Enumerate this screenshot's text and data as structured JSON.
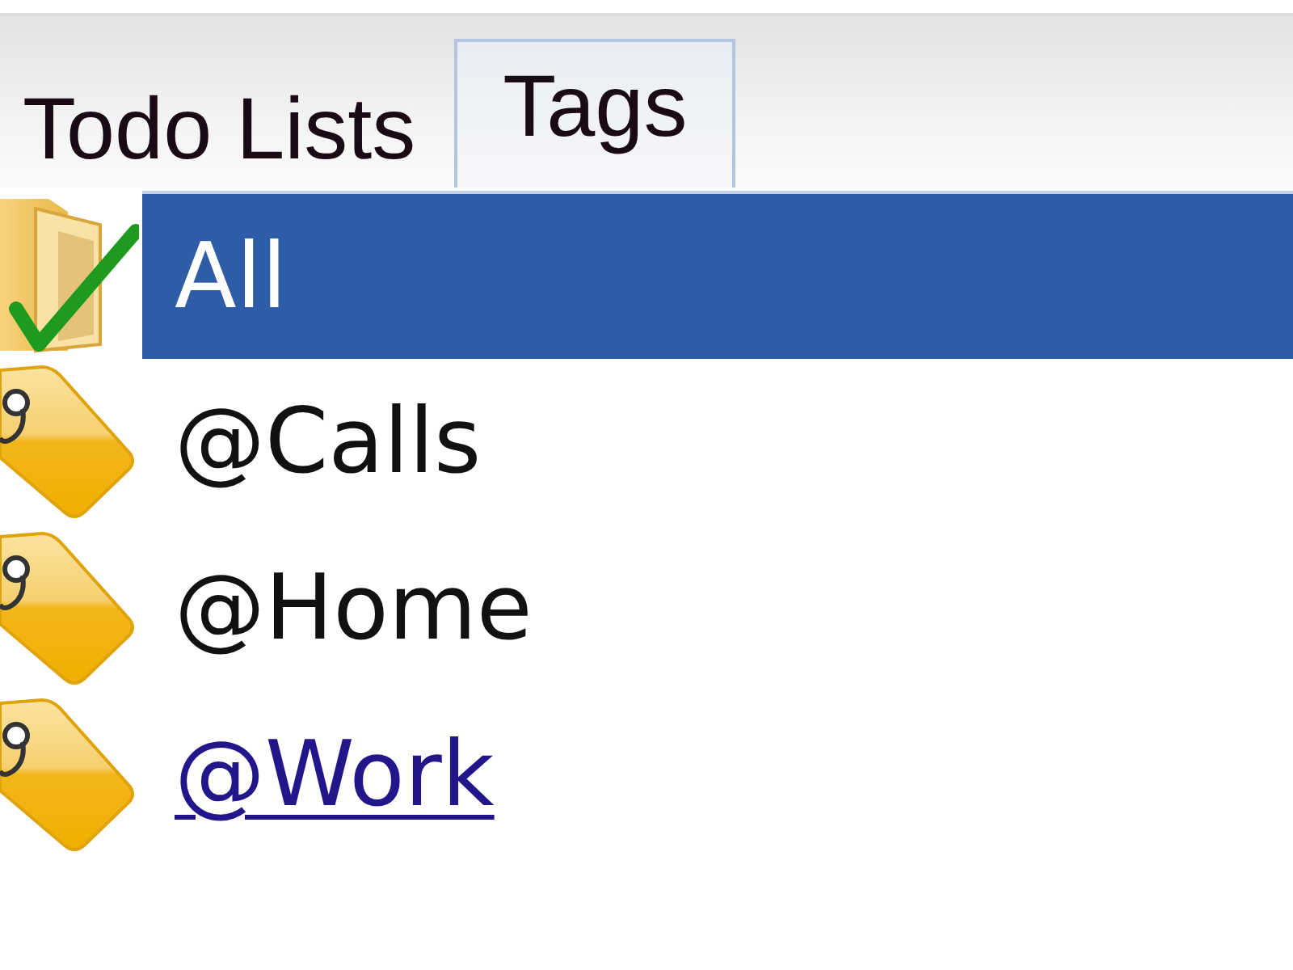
{
  "tabs": [
    {
      "label": "Todo Lists",
      "selected": false
    },
    {
      "label": "Tags",
      "selected": true
    }
  ],
  "items": [
    {
      "kind": "all",
      "label": "All",
      "selected": true,
      "hovered": false
    },
    {
      "kind": "tag",
      "label": "@Calls",
      "selected": false,
      "hovered": false
    },
    {
      "kind": "tag",
      "label": "@Home",
      "selected": false,
      "hovered": false
    },
    {
      "kind": "tag",
      "label": "@Work",
      "selected": false,
      "hovered": true
    }
  ]
}
